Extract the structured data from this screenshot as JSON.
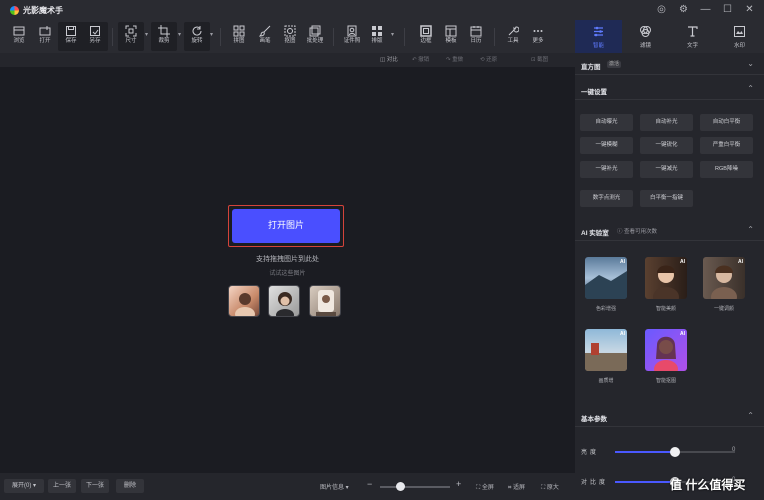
{
  "app": {
    "title": "光影魔术手"
  },
  "window_controls": [
    "◎",
    "⚙",
    "—",
    "☐",
    "✕"
  ],
  "toolbar": {
    "tools": [
      {
        "label": "浏览",
        "icon": "browse-icon"
      },
      {
        "label": "打开",
        "icon": "open-icon"
      },
      {
        "label": "保存",
        "icon": "save-icon"
      },
      {
        "label": "另存",
        "icon": "save-as-icon"
      },
      {
        "label": "尺寸",
        "icon": "resize-icon"
      },
      {
        "label": "裁剪",
        "icon": "crop-icon"
      },
      {
        "label": "旋转",
        "icon": "rotate-icon"
      },
      {
        "label": "拼图",
        "icon": "collage-icon"
      },
      {
        "label": "画笔",
        "icon": "brush-icon"
      },
      {
        "label": "抠图",
        "icon": "cutout-icon"
      },
      {
        "label": "批处理",
        "icon": "batch-icon"
      },
      {
        "label": "证件照",
        "icon": "id-photo-icon"
      },
      {
        "label": "排版",
        "icon": "layout-icon"
      },
      {
        "label": "边框",
        "icon": "border-icon"
      },
      {
        "label": "模板",
        "icon": "template-icon"
      },
      {
        "label": "日历",
        "icon": "calendar-icon"
      },
      {
        "label": "工具",
        "icon": "tools-icon"
      },
      {
        "label": "更多",
        "icon": "more-icon"
      }
    ]
  },
  "subbar": {
    "compare": "对比",
    "undo": "撤销",
    "redo": "重做",
    "restore": "还原",
    "screenshot": "截图"
  },
  "canvas": {
    "open_button": "打开图片",
    "hint": "支持拖拽图片到此处",
    "hint_sub": "试试这些图片",
    "samples": [
      "sample-1",
      "sample-2",
      "sample-3"
    ]
  },
  "bottombar": {
    "expand": "展开(0)",
    "prev": "上一张",
    "next": "下一张",
    "delete": "删除",
    "image_info": "图片信息 ▾",
    "zoom_percent": 25,
    "fullscreen": "全屏",
    "fit": "适屏",
    "original": "原大"
  },
  "right_tabs": [
    {
      "label": "智能",
      "icon": "smart-icon",
      "active": true
    },
    {
      "label": "滤镜",
      "icon": "filter-icon",
      "active": false
    },
    {
      "label": "文字",
      "icon": "text-icon",
      "active": false
    },
    {
      "label": "水印",
      "icon": "watermark-icon",
      "active": false
    }
  ],
  "panel": {
    "histogram": {
      "title": "直方图",
      "badge": "激活"
    },
    "one_click": {
      "title": "一键设置",
      "buttons": [
        "自动曝光",
        "自动补光",
        "自动白平衡",
        "一键模糊",
        "一键锐化",
        "严重白平衡",
        "一键补光",
        "一键减光",
        "RGB降噪",
        "数字点测光",
        "白平衡一指键"
      ]
    },
    "ai_lab": {
      "title": "AI 实验室",
      "more": "查看可用次数",
      "cards": [
        {
          "label": "色彩增强",
          "tag": "AI"
        },
        {
          "label": "智能美颜",
          "tag": "AI"
        },
        {
          "label": "一键调颜",
          "tag": "AI"
        },
        {
          "label": "画质增",
          "tag": "AI"
        },
        {
          "label": "智能抠图",
          "tag": "AI"
        }
      ]
    },
    "basic": {
      "title": "基本参数",
      "sliders": [
        {
          "label": "亮度",
          "value": "0",
          "level": 0.5
        },
        {
          "label": "对比度",
          "value": "0",
          "level": 0.5
        }
      ]
    }
  },
  "watermark": "值 什么值得买",
  "colors": {
    "accent": "#4a4fff",
    "highlight_border": "#d4433a",
    "active_tab": "#5f7bff"
  }
}
